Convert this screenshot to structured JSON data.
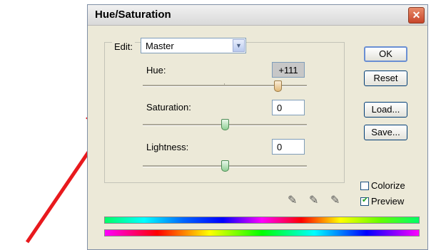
{
  "dialog": {
    "title": "Hue/Saturation",
    "close_icon": "close-icon"
  },
  "edit": {
    "label": "Edit:",
    "selected": "Master"
  },
  "sliders": {
    "hue": {
      "label": "Hue:",
      "value": "+111",
      "level": 0.82
    },
    "saturation": {
      "label": "Saturation:",
      "value": "0",
      "level": 0.5
    },
    "lightness": {
      "label": "Lightness:",
      "value": "0",
      "level": 0.5
    }
  },
  "buttons": {
    "ok": "OK",
    "reset": "Reset",
    "load": "Load...",
    "save": "Save..."
  },
  "options": {
    "colorize": {
      "label": "Colorize",
      "checked": false
    },
    "preview": {
      "label": "Preview",
      "checked": true
    }
  },
  "tools": [
    "eyedropper-icon",
    "eyedropper-plus-icon",
    "eyedropper-minus-icon"
  ],
  "colors": {
    "annotation_arrow": "#e8191d",
    "accent": "#003c74"
  }
}
